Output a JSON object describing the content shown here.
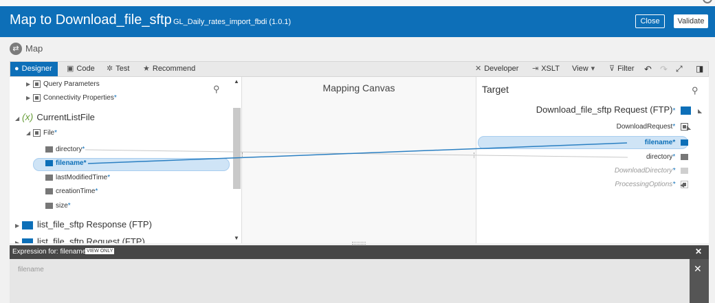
{
  "header": {
    "title": "Map to Download_file_sftp",
    "subtitle": "GL_Daily_rates_import_fbdi (1.0.1)",
    "close_label": "Close",
    "validate_label": "Validate"
  },
  "breadcrumb": {
    "label": "Map"
  },
  "toolbar": {
    "designer_label": "Designer",
    "code_label": "Code",
    "test_label": "Test",
    "recommend_label": "Recommend",
    "developer_label": "Developer",
    "xslt_label": "XSLT",
    "view_label": "View",
    "filter_label": "Filter"
  },
  "source": {
    "query_parameters": "Query Parameters",
    "connectivity_properties": "Connectivity Properties",
    "current_list_file": "CurrentListFile",
    "variable_symbol": "(x)",
    "file": "File",
    "fields": [
      "directory",
      "filename",
      "lastModifiedTime",
      "creationTime",
      "size"
    ],
    "list_response": "list_file_sftp Response (FTP)",
    "list_request": "list_file_sftp Request (FTP)",
    "required_mark": "*"
  },
  "canvas": {
    "title": "Mapping Canvas"
  },
  "target": {
    "title": "Target",
    "request": "Download_file_sftp Request (FTP)",
    "download_request": "DownloadRequest",
    "filename": "filename",
    "directory": "directory",
    "download_directory": "DownloadDirectory",
    "processing_options": "ProcessingOptions"
  },
  "expression": {
    "label": "Expression for: filename",
    "badge": "VIEW ONLY",
    "value": "filename"
  },
  "colors": {
    "accent": "#0d6fb8",
    "selection": "#cfe4f6"
  }
}
